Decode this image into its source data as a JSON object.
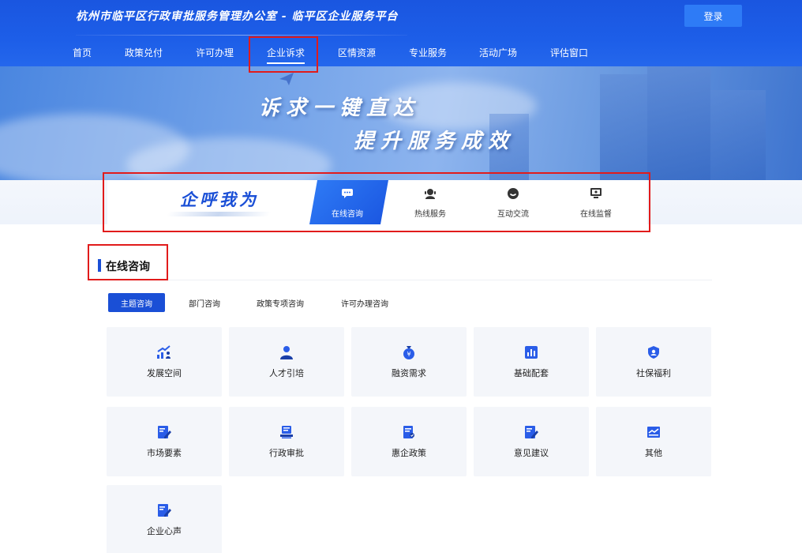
{
  "header": {
    "site_title": "杭州市临平区行政审批服务管理办公室 - 临平区企业服务平台",
    "login_label": "登录"
  },
  "nav": [
    {
      "label": "首页"
    },
    {
      "label": "政策兑付"
    },
    {
      "label": "许可办理"
    },
    {
      "label": "企业诉求",
      "active": true
    },
    {
      "label": "区情资源"
    },
    {
      "label": "专业服务"
    },
    {
      "label": "活动广场"
    },
    {
      "label": "评估窗口"
    }
  ],
  "banner": {
    "slogan_line1": "诉求一键直达",
    "slogan_line2": "提升服务成效"
  },
  "service_strip": {
    "brand": "企呼我为",
    "tabs": [
      {
        "label": "在线咨询",
        "icon": "chat-bubble-icon",
        "active": true
      },
      {
        "label": "热线服务",
        "icon": "headset-icon"
      },
      {
        "label": "互动交流",
        "icon": "smile-icon"
      },
      {
        "label": "在线监督",
        "icon": "monitor-icon"
      }
    ]
  },
  "section": {
    "title": "在线咨询",
    "subtabs": [
      {
        "label": "主题咨询",
        "active": true
      },
      {
        "label": "部门咨询"
      },
      {
        "label": "政策专项咨询"
      },
      {
        "label": "许可办理咨询"
      }
    ],
    "cards": [
      {
        "label": "发展空间",
        "icon": "growth-chart-icon"
      },
      {
        "label": "人才引培",
        "icon": "person-icon"
      },
      {
        "label": "融资需求",
        "icon": "money-bag-icon"
      },
      {
        "label": "基础配套",
        "icon": "bar-chart-icon"
      },
      {
        "label": "社保福利",
        "icon": "shield-user-icon"
      },
      {
        "label": "市场要素",
        "icon": "edit-doc-icon"
      },
      {
        "label": "行政审批",
        "icon": "stamp-icon"
      },
      {
        "label": "惠企政策",
        "icon": "policy-doc-icon"
      },
      {
        "label": "意见建议",
        "icon": "edit-doc-icon"
      },
      {
        "label": "其他",
        "icon": "mail-icon"
      },
      {
        "label": "企业心声",
        "icon": "edit-doc-icon"
      }
    ]
  },
  "colors": {
    "primary": "#1a4fd6",
    "header": "#1d5ee8",
    "login": "#2e7bf6",
    "highlight": "#e11b1b",
    "card_bg": "#f4f6fa"
  }
}
